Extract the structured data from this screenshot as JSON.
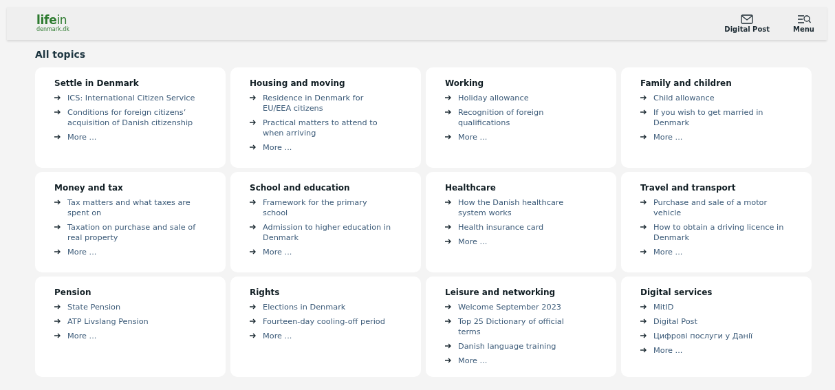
{
  "header": {
    "logo": {
      "main": "life",
      "suffix": "in",
      "domain": "denmark.dk"
    },
    "actions": [
      {
        "kind": "mail",
        "label": "Digital Post"
      },
      {
        "kind": "menu",
        "label": "Menu"
      }
    ]
  },
  "page_title": "All topics",
  "topics": [
    {
      "title": "Settle in Denmark",
      "links": [
        "ICS: International Citizen Service",
        "Conditions for foreign citizens’ acquisition of Danish citizenship",
        "More ..."
      ]
    },
    {
      "title": "Housing and moving",
      "links": [
        "Residence in Denmark for EU/EEA citizens",
        "Practical matters to attend to when arriving",
        "More ..."
      ]
    },
    {
      "title": "Working",
      "links": [
        "Holiday allowance",
        "Recognition of foreign qualifications",
        "More ..."
      ]
    },
    {
      "title": "Family and children",
      "links": [
        "Child allowance",
        "If you wish to get married in Denmark",
        "More ..."
      ]
    },
    {
      "title": "Money and tax",
      "links": [
        "Tax matters and what taxes are spent on",
        "Taxation on purchase and sale of real property",
        "More ..."
      ]
    },
    {
      "title": "School and education",
      "links": [
        "Framework for the primary school",
        "Admission to higher education in Denmark",
        "More ..."
      ]
    },
    {
      "title": "Healthcare",
      "links": [
        "How the Danish healthcare system works",
        "Health insurance card",
        "More ..."
      ]
    },
    {
      "title": "Travel and transport",
      "links": [
        "Purchase and sale of a motor vehicle",
        "How to obtain a driving licence in Denmark",
        "More ..."
      ]
    },
    {
      "title": "Pension",
      "links": [
        "State Pension",
        "ATP Livslang Pension",
        "More ..."
      ]
    },
    {
      "title": "Rights",
      "links": [
        "Elections in Denmark",
        "Fourteen-day cooling-off period",
        "More ..."
      ]
    },
    {
      "title": "Leisure and networking",
      "links": [
        "Welcome September 2023",
        "Top 25 Dictionary of official terms",
        "Danish language training",
        "More ..."
      ]
    },
    {
      "title": "Digital services",
      "links": [
        "MitID",
        "Digital Post",
        "Цифрові послуги у Данії",
        "More ..."
      ]
    }
  ]
}
